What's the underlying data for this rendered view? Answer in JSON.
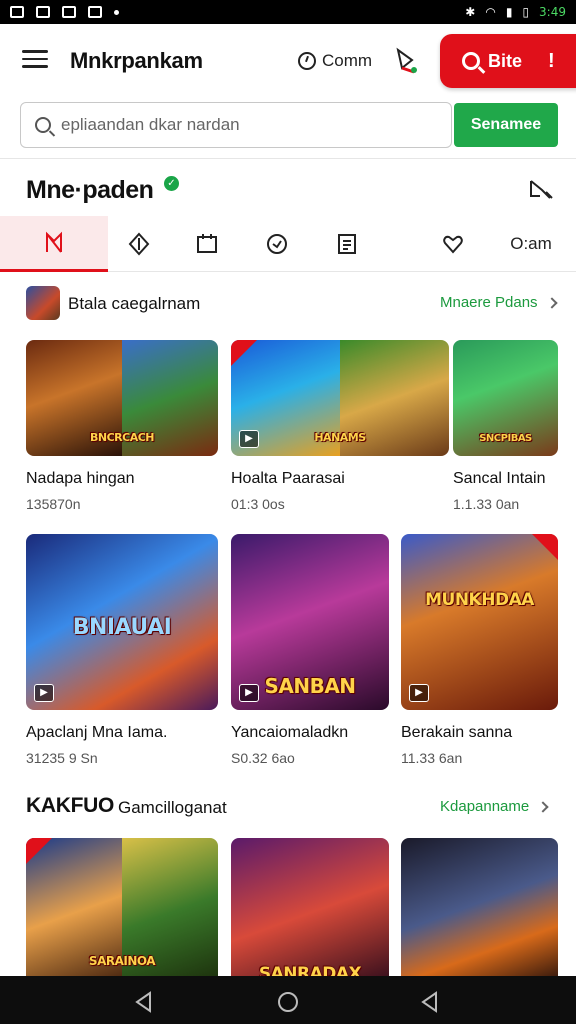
{
  "status_bar": {
    "time": "3:49"
  },
  "app_bar": {
    "title": "Mnkrpankam",
    "comm_label": "Comm",
    "site_button_label": "Bite",
    "site_button_alert": "!"
  },
  "search": {
    "placeholder": "epliaandan dkar nardan",
    "button_label": "Senamee"
  },
  "page": {
    "title": "Mne·paden"
  },
  "tabs": [
    {
      "icon": "bookmark-icon",
      "active": true
    },
    {
      "icon": "diamond-icon",
      "active": false
    },
    {
      "icon": "calendar-icon",
      "active": false
    },
    {
      "icon": "shield-icon",
      "active": false
    },
    {
      "icon": "list-icon",
      "active": false
    },
    {
      "icon": "heart-icon",
      "active": false
    },
    {
      "label": "O:am",
      "active": false
    }
  ],
  "sections": [
    {
      "title": "Btala caegalrnam",
      "more_label": "Mnaere Pdans",
      "cards": [
        {
          "title": "Nadapa hingan",
          "meta": "135870n",
          "banner": "BNCRCACH"
        },
        {
          "title": "Hoalta Paarasai",
          "meta": "01:3 0os",
          "banner": "HANAMS"
        },
        {
          "title": "Sancal Intain",
          "meta": "1.1.33 0an",
          "banner": "SNCPIBAS"
        }
      ]
    },
    {
      "cards": [
        {
          "title": "Apaclanj Mna Iama.",
          "meta": "31235 9 Sn",
          "banner": "BNIAUAI"
        },
        {
          "title": "Yancaiomaladkn",
          "meta": "S0.32 6ao",
          "banner": "SANBAN"
        },
        {
          "title": "Berakain sanna",
          "meta": "11.33 6an",
          "banner": "MUNKHDAA"
        }
      ]
    },
    {
      "title": "KAKFUO",
      "subtitle": "Gamcilloganat",
      "more_label": "Kdapanname",
      "cards": [
        {
          "banner": "SARAINOA"
        },
        {
          "banner": "SANRADAX"
        },
        {
          "banner": ""
        }
      ]
    }
  ],
  "colors": {
    "accent_red": "#e0101a",
    "accent_green": "#20a84a",
    "link_green": "#1c9a3e"
  }
}
